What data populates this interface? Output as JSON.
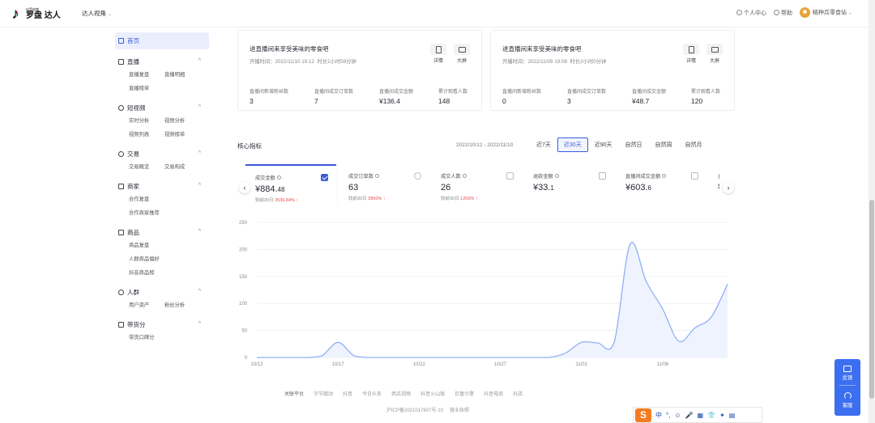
{
  "header": {
    "logo_small": "抖音电商",
    "logo_main": "罗盘 达人",
    "perspective": "达人视角",
    "personal_center": "个人中心",
    "help": "帮助",
    "account_name": "精种兵零食站"
  },
  "sidebar": {
    "home": "首页",
    "groups": [
      {
        "label": "直播",
        "items": [
          "直播复盘",
          "直播明细",
          "直播榜单"
        ]
      },
      {
        "label": "短视频",
        "items": [
          "实时分析",
          "视频分析",
          "视频列表",
          "视频榜单"
        ]
      },
      {
        "label": "交易",
        "items": [
          "交易概览",
          "交易构成"
        ]
      },
      {
        "label": "商家",
        "items": [
          "合作复盘",
          "合作商家推荐"
        ]
      },
      {
        "label": "商品",
        "items": [
          "商品复盘",
          "人群商品偏好",
          "抖音商品榜"
        ]
      },
      {
        "label": "人群",
        "items": [
          "用户资产",
          "粉丝分析"
        ]
      },
      {
        "label": "带货分",
        "items": [
          "带货口碑分"
        ]
      }
    ]
  },
  "live_cards": [
    {
      "title": "进直播间来享受美味的零食吧",
      "start_time": "开播时间：2022/11/10 19:12",
      "duration": "时长1小时59分钟",
      "btn_detail": "详情",
      "btn_screen": "大屏",
      "stats": [
        {
          "label": "直播间新增粉丝数",
          "value": "3"
        },
        {
          "label": "直播间成交订单数",
          "value": "7"
        },
        {
          "label": "直播间成交金额",
          "value": "¥136.4"
        },
        {
          "label": "累计观看人数",
          "value": "148"
        }
      ]
    },
    {
      "title": "进直播间来享受美味的零食吧",
      "start_time": "开播时间：2022/11/09 19:08",
      "duration": "时长2小时0分钟",
      "btn_detail": "详情",
      "btn_screen": "大屏",
      "stats": [
        {
          "label": "直播间新增粉丝数",
          "value": "0"
        },
        {
          "label": "直播间成交订单数",
          "value": "3"
        },
        {
          "label": "直播间成交金额",
          "value": "¥48.7"
        },
        {
          "label": "累计观看人数",
          "value": "120"
        }
      ]
    }
  ],
  "core": {
    "title": "核心指标",
    "date_range": "2022/10/12 - 2022/11/10",
    "tabs": [
      "近7天",
      "近30天",
      "近90天",
      "自然日",
      "自然周",
      "自然月"
    ],
    "active_tab": 1,
    "metrics": [
      {
        "label": "成交金额",
        "value_main": "¥884.",
        "value_dec": "48",
        "compare": "较前30日",
        "change": "3536.84%",
        "checked": true
      },
      {
        "label": "成交订单数",
        "value_main": "63",
        "value_dec": "",
        "compare": "较前30日",
        "change": "3950%",
        "checked": false
      },
      {
        "label": "成交人数",
        "value_main": "26",
        "value_dec": "",
        "compare": "较前30日",
        "change": "1200%",
        "checked": false
      },
      {
        "label": "退款金额",
        "value_main": "¥33.",
        "value_dec": "1",
        "compare": "",
        "change": "",
        "checked": false
      },
      {
        "label": "直播间成交金额",
        "value_main": "¥603.",
        "value_dec": "6",
        "compare": "",
        "change": "",
        "checked": false
      },
      {
        "label": "直播",
        "value_main": "¥",
        "value_dec": "",
        "compare": "",
        "change": "",
        "checked": false
      }
    ]
  },
  "chart_data": {
    "type": "area",
    "x_tick_labels": [
      "10/12",
      "10/17",
      "10/22",
      "10/27",
      "11/01",
      "11/06"
    ],
    "y_ticks": [
      0,
      50,
      100,
      150,
      200,
      250
    ],
    "ylim": [
      0,
      250
    ],
    "x_days": [
      "10/12",
      "10/13",
      "10/14",
      "10/15",
      "10/16",
      "10/17",
      "10/18",
      "10/19",
      "10/20",
      "10/21",
      "10/22",
      "10/23",
      "10/24",
      "10/25",
      "10/26",
      "10/27",
      "10/28",
      "10/29",
      "10/30",
      "10/31",
      "11/01",
      "11/02",
      "11/03",
      "11/04",
      "11/05",
      "11/06",
      "11/07",
      "11/08",
      "11/09",
      "11/10"
    ],
    "series": [
      {
        "values": [
          0,
          0,
          0,
          0,
          3,
          28,
          3,
          0,
          0,
          0,
          0,
          0,
          0,
          0,
          0,
          0,
          0,
          0,
          0,
          8,
          28,
          27,
          27,
          210,
          140,
          90,
          30,
          55,
          75,
          136
        ]
      }
    ],
    "line_color": "#8fb0f5",
    "fill_color": "#eef3fe"
  },
  "footer": {
    "links": [
      "关联平台",
      "字节跳动",
      "抖音",
      "今日头条",
      "西瓜视频",
      "抖音火山版",
      "巨量引擎",
      "抖音电商",
      "抖店"
    ],
    "icp": "沪ICP备2021017807号-10",
    "license": "营业执照"
  },
  "ime": {
    "logo": "S",
    "items": [
      "中",
      "°,",
      "☺",
      "🎤",
      "▦",
      "👕",
      "✦",
      "▤"
    ]
  },
  "feedback": {
    "feedback_label": "反馈",
    "service_label": "客服"
  }
}
